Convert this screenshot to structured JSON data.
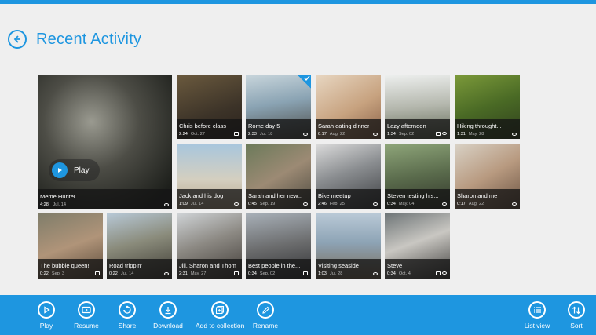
{
  "page": {
    "title": "Recent Activity"
  },
  "featured": {
    "title": "Meme Hunter",
    "duration": "4:28",
    "date": "Jul. 14",
    "play_label": "Play"
  },
  "tiles": [
    {
      "title": "Chris before class",
      "duration": "2:24",
      "date": "Oct. 27"
    },
    {
      "title": "Rome day 5",
      "duration": "2:33",
      "date": "Jul. 18"
    },
    {
      "title": "Sarah eating dinner",
      "duration": "0:17",
      "date": "Aug. 22"
    },
    {
      "title": "Lazy afternoon",
      "duration": "1:34",
      "date": "Sep. 02"
    },
    {
      "title": "Hiking throught...",
      "duration": "1:31",
      "date": "May. 28"
    },
    {
      "title": "Jack and his dog",
      "duration": "1:09",
      "date": "Jul. 14"
    },
    {
      "title": "Sarah and her new...",
      "duration": "0:45",
      "date": "Sep. 19"
    },
    {
      "title": "Bike meetup",
      "duration": "2:46",
      "date": "Feb. 25"
    },
    {
      "title": "Steven testing his...",
      "duration": "0:34",
      "date": "May. 04"
    },
    {
      "title": "Sharon and me",
      "duration": "0:17",
      "date": "Aug. 22"
    },
    {
      "title": "The bubble queen!",
      "duration": "0:22",
      "date": "Sep. 3"
    },
    {
      "title": "Road trippin'",
      "duration": "0:22",
      "date": "Jul. 14"
    },
    {
      "title": "Jill, Sharon and Thom",
      "duration": "2:31",
      "date": "May. 27"
    },
    {
      "title": "Best people in the...",
      "duration": "0:34",
      "date": "Sep. 02"
    },
    {
      "title": "Visiting seaside",
      "duration": "1:03",
      "date": "Jul. 28"
    },
    {
      "title": "Steve",
      "duration": "0:34",
      "date": "Oct. 4"
    }
  ],
  "appbar": {
    "play": "Play",
    "resume": "Resume",
    "share": "Share",
    "download": "Download",
    "add_to_collection": "Add to collection",
    "rename": "Rename",
    "list_view": "List view",
    "sort": "Sort"
  },
  "colors": {
    "accent": "#1e96e0",
    "background": "#efefef",
    "caption_bg": "#141414"
  },
  "icons": {
    "back": "back-arrow-icon",
    "play": "play-icon",
    "resume": "resume-icon",
    "share": "share-icon",
    "download": "download-icon",
    "add_to_collection": "add-to-collection-icon",
    "rename": "pencil-icon",
    "list_view": "list-view-icon",
    "sort": "sort-icon"
  }
}
